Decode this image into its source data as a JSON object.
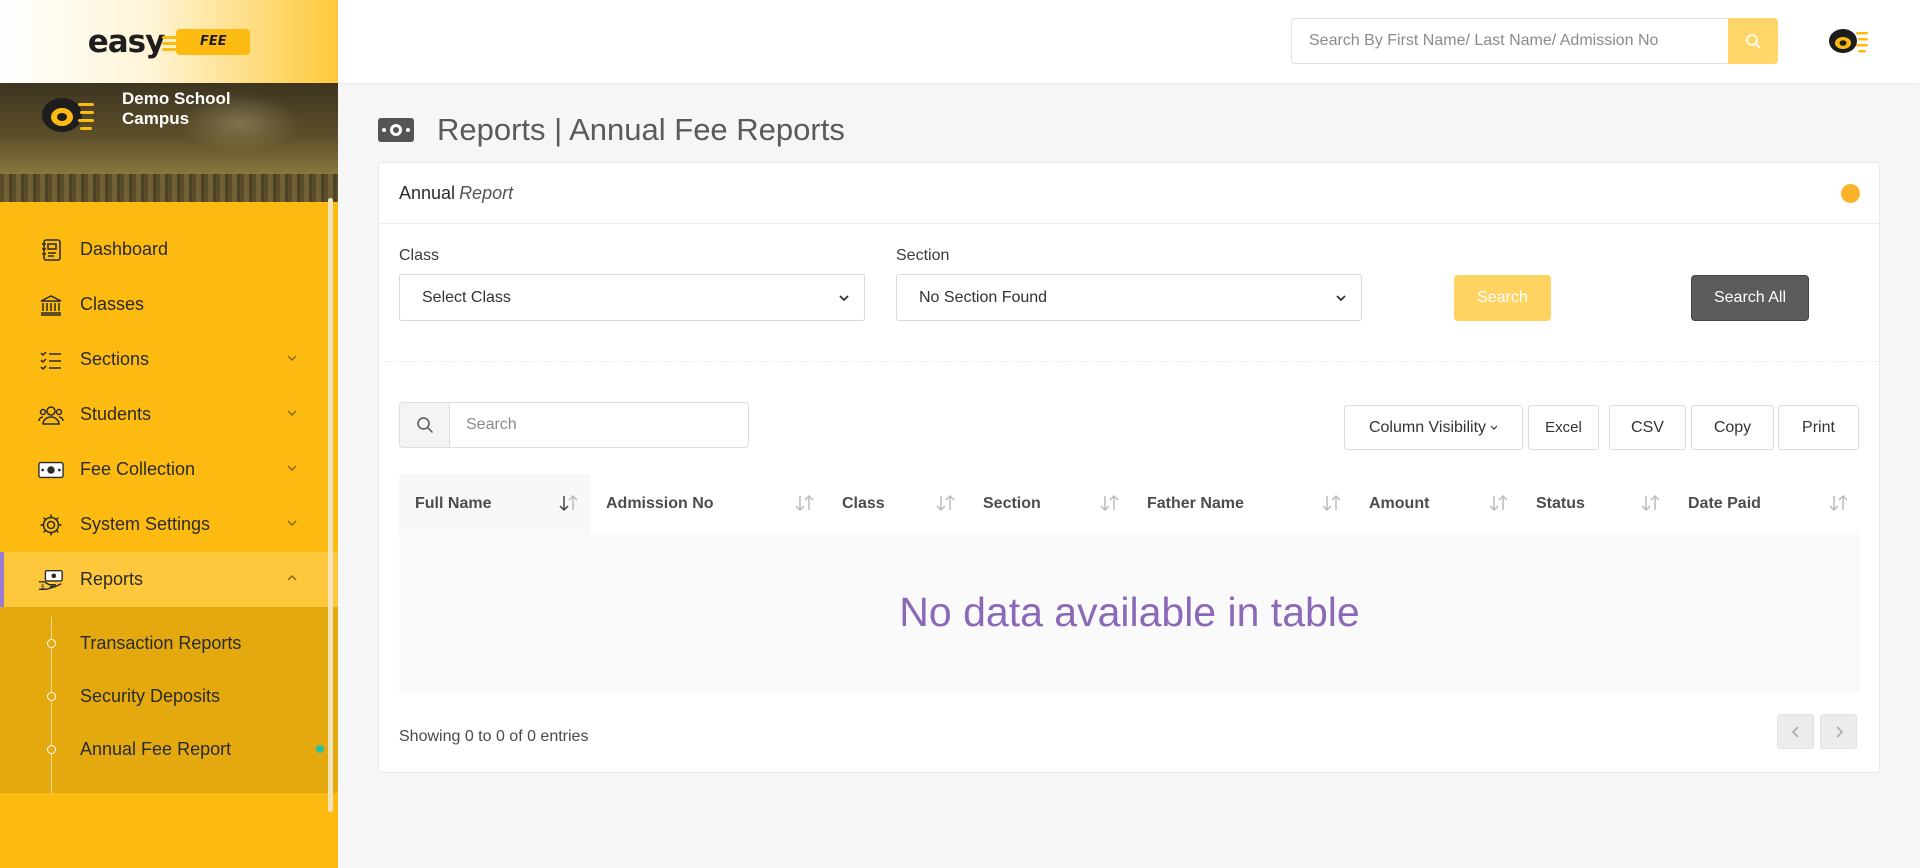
{
  "brand": {
    "word": "easy",
    "badge": "FEE"
  },
  "campus": {
    "name": "Demo School Campus"
  },
  "sidebar": {
    "items": [
      {
        "label": "Dashboard"
      },
      {
        "label": "Classes"
      },
      {
        "label": "Sections"
      },
      {
        "label": "Students"
      },
      {
        "label": "Fee Collection"
      },
      {
        "label": "System Settings"
      },
      {
        "label": "Reports"
      }
    ],
    "sub_items": [
      {
        "label": "Transaction Reports"
      },
      {
        "label": "Security Deposits"
      },
      {
        "label": "Annual Fee Report"
      }
    ]
  },
  "header": {
    "search_placeholder": "Search By First Name/ Last Name/ Admission No"
  },
  "page": {
    "title": "Reports | Annual Fee Reports"
  },
  "card": {
    "title": "Annual",
    "title_em": "Report"
  },
  "filters": {
    "class_label": "Class",
    "class_value": "Select Class",
    "section_label": "Section",
    "section_value": "No Section Found",
    "search_label": "Search",
    "search_all_label": "Search All"
  },
  "table": {
    "search_placeholder": "Search",
    "buttons": {
      "column_visibility": "Column Visibility",
      "excel": "Excel",
      "csv": "CSV",
      "copy": "Copy",
      "print": "Print"
    },
    "columns": [
      "Full Name",
      "Admission No",
      "Class",
      "Section",
      "Father Name",
      "Amount",
      "Status",
      "Date Paid"
    ],
    "empty_message": "No data available in table",
    "info": "Showing 0 to 0 of 0 entries"
  },
  "colors": {
    "sidebar": "#fdbb12",
    "accent_purple": "#8b69b8",
    "search_button": "#fed66a",
    "status_dot": "#fdb22c",
    "active_indicator": "#27c2a3"
  }
}
